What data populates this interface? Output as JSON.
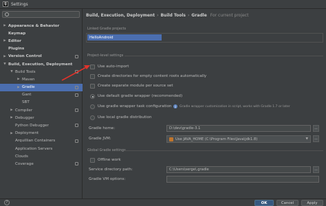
{
  "window": {
    "app_icon_text": "IJ",
    "title": "Settings"
  },
  "sidebar": {
    "search_placeholder": "",
    "items": [
      {
        "label": "Appearance & Behavior",
        "arrow": "▶",
        "indent": 0,
        "bold": true,
        "selected": false,
        "cfg": false
      },
      {
        "label": "Keymap",
        "arrow": "",
        "indent": 0,
        "bold": true,
        "selected": false,
        "cfg": false
      },
      {
        "label": "Editor",
        "arrow": "▶",
        "indent": 0,
        "bold": true,
        "selected": false,
        "cfg": false
      },
      {
        "label": "Plugins",
        "arrow": "",
        "indent": 0,
        "bold": true,
        "selected": false,
        "cfg": false
      },
      {
        "label": "Version Control",
        "arrow": "▶",
        "indent": 0,
        "bold": true,
        "selected": false,
        "cfg": true
      },
      {
        "label": "Build, Execution, Deployment",
        "arrow": "▼",
        "indent": 0,
        "bold": true,
        "selected": false,
        "cfg": false
      },
      {
        "label": "Build Tools",
        "arrow": "▼",
        "indent": 1,
        "bold": false,
        "selected": false,
        "cfg": true
      },
      {
        "label": "Maven",
        "arrow": "▶",
        "indent": 2,
        "bold": false,
        "selected": false,
        "cfg": false
      },
      {
        "label": "Gradle",
        "arrow": "▶",
        "indent": 2,
        "bold": false,
        "selected": true,
        "cfg": true
      },
      {
        "label": "Gant",
        "arrow": "",
        "indent": 2,
        "bold": false,
        "selected": false,
        "cfg": true
      },
      {
        "label": "SBT",
        "arrow": "",
        "indent": 2,
        "bold": false,
        "selected": false,
        "cfg": false
      },
      {
        "label": "Compiler",
        "arrow": "▶",
        "indent": 1,
        "bold": false,
        "selected": false,
        "cfg": true
      },
      {
        "label": "Debugger",
        "arrow": "▶",
        "indent": 1,
        "bold": false,
        "selected": false,
        "cfg": false
      },
      {
        "label": "Python Debugger",
        "arrow": "",
        "indent": 1,
        "bold": false,
        "selected": false,
        "cfg": true
      },
      {
        "label": "Deployment",
        "arrow": "▶",
        "indent": 1,
        "bold": false,
        "selected": false,
        "cfg": false
      },
      {
        "label": "Arquillian Containers",
        "arrow": "",
        "indent": 1,
        "bold": false,
        "selected": false,
        "cfg": true
      },
      {
        "label": "Application Servers",
        "arrow": "",
        "indent": 1,
        "bold": false,
        "selected": false,
        "cfg": false
      },
      {
        "label": "Clouds",
        "arrow": "",
        "indent": 1,
        "bold": false,
        "selected": false,
        "cfg": false
      },
      {
        "label": "Coverage",
        "arrow": "",
        "indent": 1,
        "bold": false,
        "selected": false,
        "cfg": true
      }
    ]
  },
  "breadcrumb": {
    "part1": "Build, Execution, Deployment",
    "part2": "Build Tools",
    "part3": "Gradle",
    "separator": "›",
    "scope": "For current project"
  },
  "linked_projects": {
    "label": "Linked Gradle projects",
    "items": [
      "HelloAndroid"
    ]
  },
  "project_settings": {
    "label": "Project-level settings",
    "auto_import": "Use auto-import",
    "create_dirs": "Create directories for empty content roots automatically",
    "separate_module": "Create separate module per source set",
    "default_wrapper": "Use default gradle wrapper (recommended)",
    "task_wrapper": "Use gradle wrapper task configuration",
    "task_wrapper_hint": "Gradle wrapper customization in script, works with Gradle 1.7 or later",
    "local_distribution": "Use local gradle distribution",
    "gradle_home_label": "Gradle home:",
    "gradle_home_value": "D:\\dev\\gradle-3.1",
    "gradle_jvm_label": "Gradle JVM:",
    "gradle_jvm_value": "Use JAVA_HOME (C:\\Program Files\\Java\\jdk1.8)",
    "browse_label": "..."
  },
  "global_settings": {
    "label": "Global Gradle settings",
    "offline": "Offline work",
    "service_dir_label": "Service directory path:",
    "service_dir_value": "C:\\Users\\serge\\.gradle",
    "vm_options_label": "Gradle VM options:",
    "vm_options_value": ""
  },
  "footer": {
    "help": "?",
    "ok": "OK",
    "cancel": "Cancel",
    "apply": "Apply"
  },
  "colors": {
    "accent": "#4b6eaf",
    "background": "#3c3f41",
    "arrow": "#e0332b"
  }
}
